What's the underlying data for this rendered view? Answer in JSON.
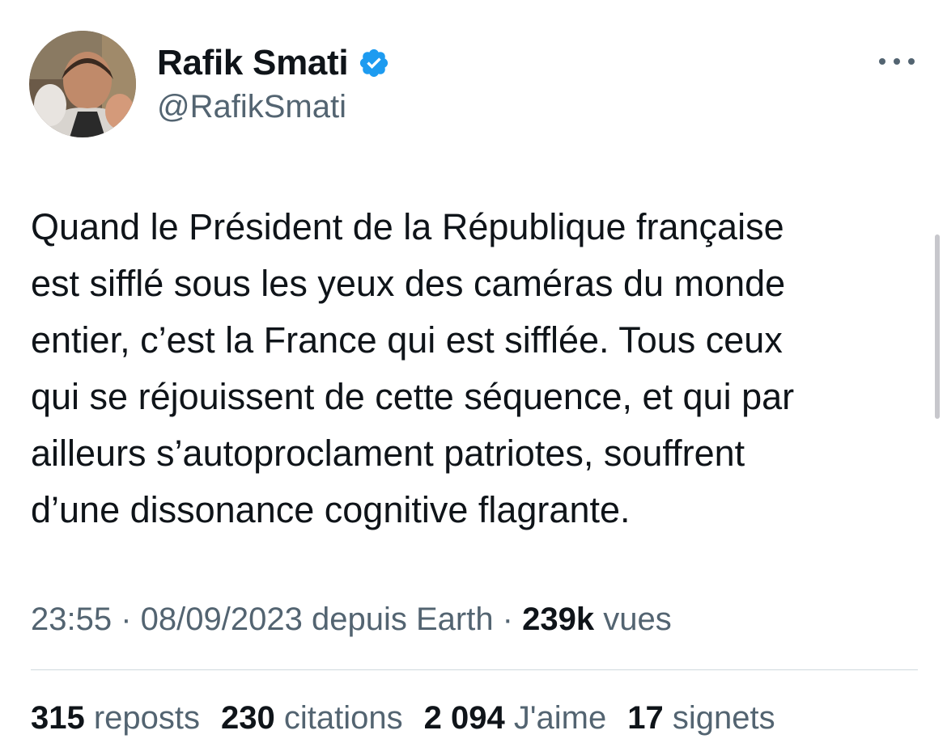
{
  "author": {
    "display_name": "Rafik Smati",
    "handle": "@RafikSmati",
    "verified": true
  },
  "tweet": {
    "lines": [
      "Quand le Président de la République française",
      "est sifflé sous les yeux des caméras du monde",
      "entier, c’est la France qui est sifflée. Tous ceux",
      "qui se réjouissent de cette séquence, et qui par",
      "ailleurs s’autoproclament patriotes, souffrent",
      "d’une dissonance cognitive flagrante."
    ]
  },
  "meta": {
    "time": "23:55",
    "sep1": " · ",
    "date": "08/09/2023",
    "source": " depuis Earth",
    "sep2": " · ",
    "views_count": "239k",
    "views_label": " vues"
  },
  "stats": {
    "reposts_count": "315",
    "reposts_label": " reposts",
    "quotes_count": "230",
    "quotes_label": " citations",
    "likes_count": "2 094",
    "likes_label": " J'aime",
    "bookmarks_count": "17",
    "bookmarks_label": " signets"
  },
  "icons": {
    "verified": "verified-badge-icon",
    "more": "more-options-icon"
  },
  "colors": {
    "text": "#0f1419",
    "secondary": "#536471",
    "verified": "#1d9bf0",
    "divider": "#cfd9de"
  }
}
